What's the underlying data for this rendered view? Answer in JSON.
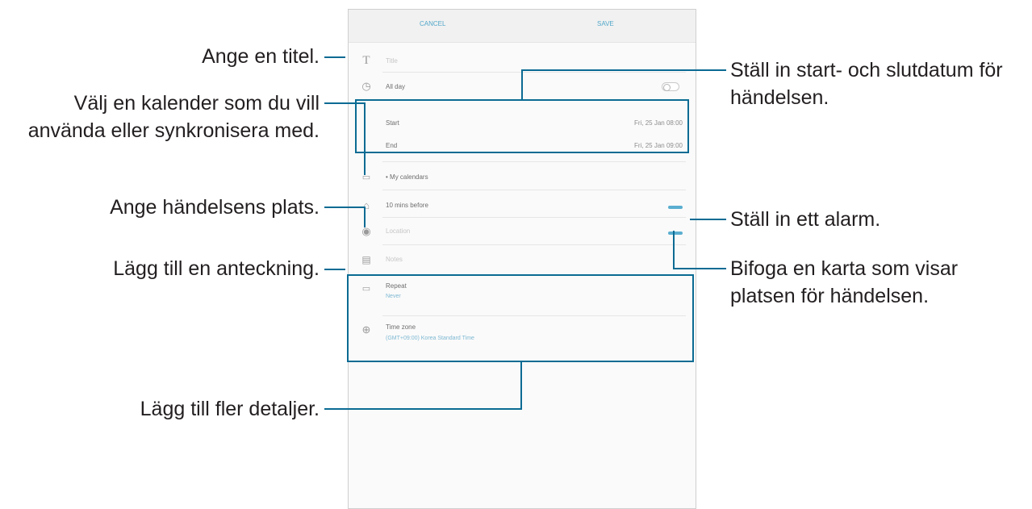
{
  "callouts": {
    "title": "Ange en titel.",
    "calendar_line1": "Välj en kalender som du vill",
    "calendar_line2": "använda eller synkronisera med.",
    "location": "Ange händelsens plats.",
    "note": "Lägg till en anteckning.",
    "details": "Lägg till fler detaljer.",
    "dates_line1": "Ställ in start- och slutdatum för",
    "dates_line2": "händelsen.",
    "alarm": "Ställ in ett alarm.",
    "map_line1": "Bifoga en karta som visar",
    "map_line2": "platsen för händelsen."
  },
  "device": {
    "cancel_label": "CANCEL",
    "save_label": "SAVE",
    "title_placeholder": "Title",
    "all_day_label": "All day",
    "start_label": "Start",
    "start_value": "Fri, 25 Jan   08:00",
    "end_label": "End",
    "end_value": "Fri, 25 Jan   09:00",
    "calendar_label": "• My calendars",
    "reminder_label": "10 mins before",
    "location_placeholder": "Location",
    "notes_placeholder": "Notes",
    "repeat_label": "Repeat",
    "repeat_value": "Never",
    "timezone_label": "Time zone",
    "timezone_value": "(GMT+09:00) Korea Standard Time"
  },
  "colors": {
    "accent": "#0a6b93",
    "device_blue": "#5aaed0"
  }
}
